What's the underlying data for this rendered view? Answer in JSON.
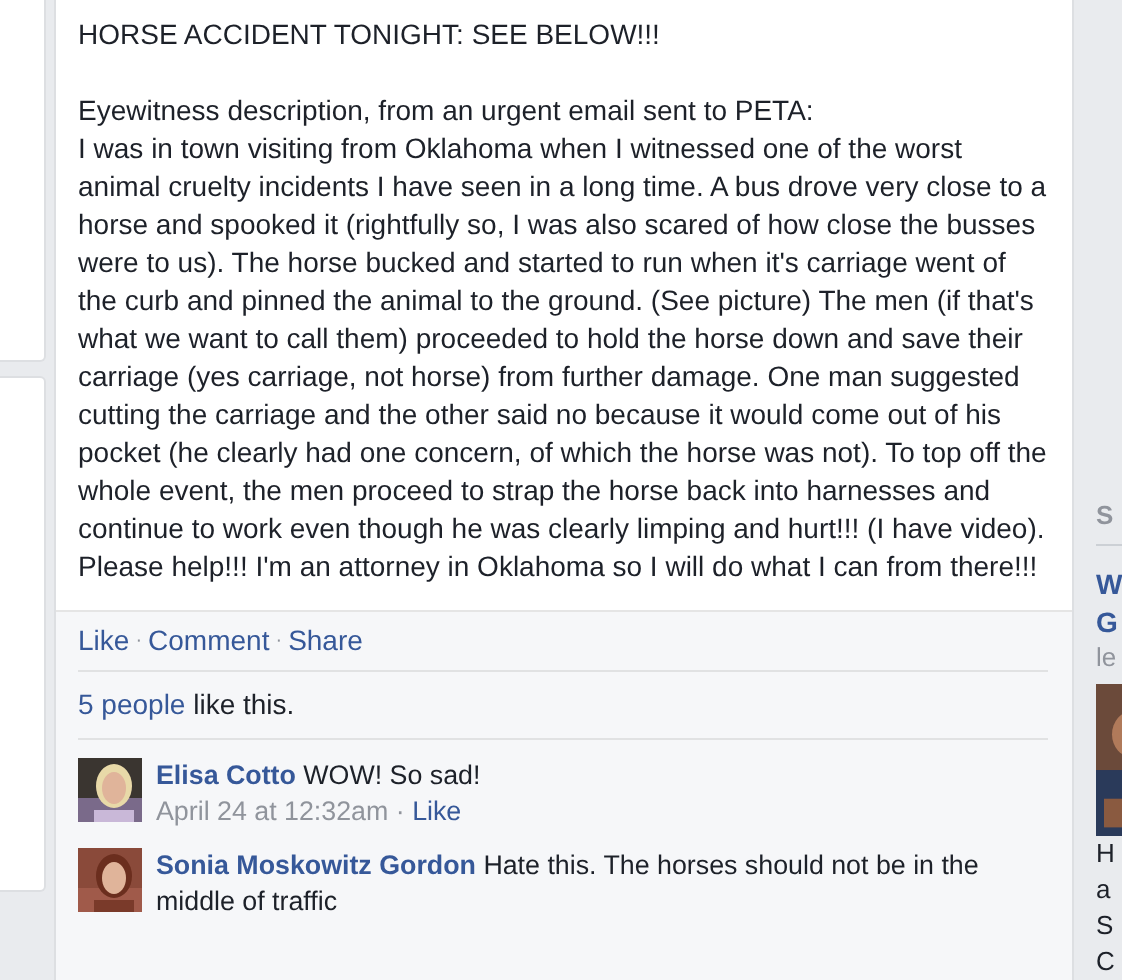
{
  "post": {
    "heading": "HORSE ACCIDENT TONIGHT: SEE BELOW!!!",
    "paragraphs": [
      "Eyewitness description, from an urgent email sent to PETA:",
      "I was in town visiting from Oklahoma when I witnessed one of the worst animal cruelty incidents I have seen in a long time. A bus drove very close to a horse and spooked it (rightfully so, I was also scared of how close the busses were to us). The horse bucked and started to run when it's carriage went of the curb and pinned the animal to the ground. (See picture) The men (if that's what we want to call them) proceeded to hold the horse down and save their carriage (yes carriage, not horse) from further damage. One man suggested cutting the carriage and the other said no because it would come out of his pocket (he clearly had one concern, of which the horse was not). To top off the whole event, the men proceed to strap the horse back into harnesses and continue to work even though he was clearly limping and hurt!!! (I have video). Please help!!! I'm an attorney in Oklahoma so I will do what I can from there!!!"
    ]
  },
  "actions": [
    "Like",
    "Comment",
    "Share"
  ],
  "separator": "·",
  "likes": {
    "link": "5 people",
    "text": "like this."
  },
  "comments": [
    {
      "author": "Elisa Cotto",
      "text": "WOW! So sad!",
      "time": "April 24 at 12:32am",
      "like": "Like"
    },
    {
      "author": "Sonia Moskowitz Gordon",
      "text": "Hate this. The horses should not be in the middle of traffic"
    }
  ],
  "sidebar": {
    "heading": "S",
    "title_lines": [
      "W",
      "G"
    ],
    "subtitle": "le",
    "body_lines": [
      "H",
      "a",
      "S",
      "C"
    ]
  }
}
